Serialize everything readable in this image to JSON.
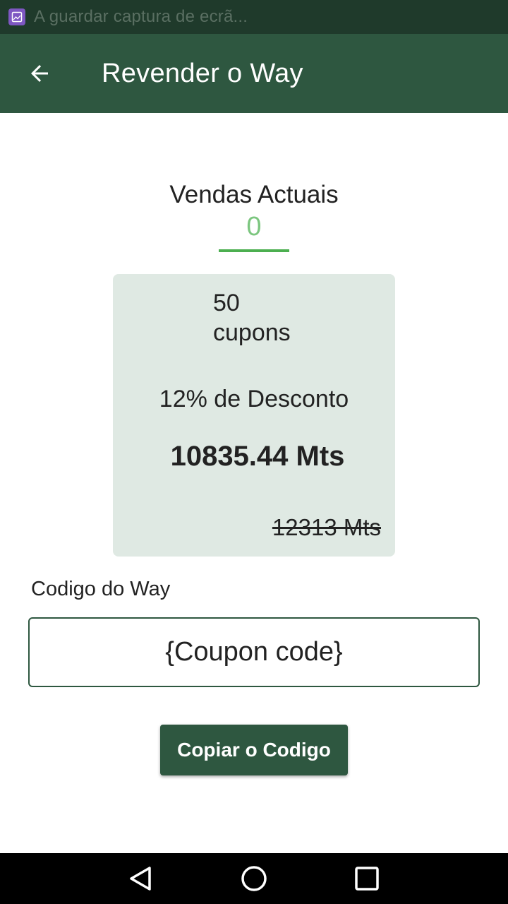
{
  "status_bar": {
    "notification_text": "A guardar captura de ecrã...",
    "icon": "screenshot-icon"
  },
  "app_bar": {
    "title": "Revender o Way",
    "back_icon": "arrow-back-icon"
  },
  "sales": {
    "label": "Vendas Actuais",
    "value": "0"
  },
  "offer": {
    "coupon_count": "50",
    "coupon_unit": "cupons",
    "discount": "12% de Desconto",
    "final_price": "10835.44 Mts",
    "original_price": "12313 Mts"
  },
  "code": {
    "label": "Codigo do Way",
    "value": "{Coupon code}"
  },
  "copy_button": {
    "label": "Copiar o Codigo"
  },
  "nav": {
    "back_icon": "nav-back-icon",
    "home_icon": "nav-home-icon",
    "recents_icon": "nav-recents-icon"
  },
  "colors": {
    "primary": "#2e5740",
    "status_bar": "#1f3a2b",
    "accent_green": "#4caf50",
    "sales_value": "#7cc67f",
    "card_bg": "#dfe9e3"
  }
}
